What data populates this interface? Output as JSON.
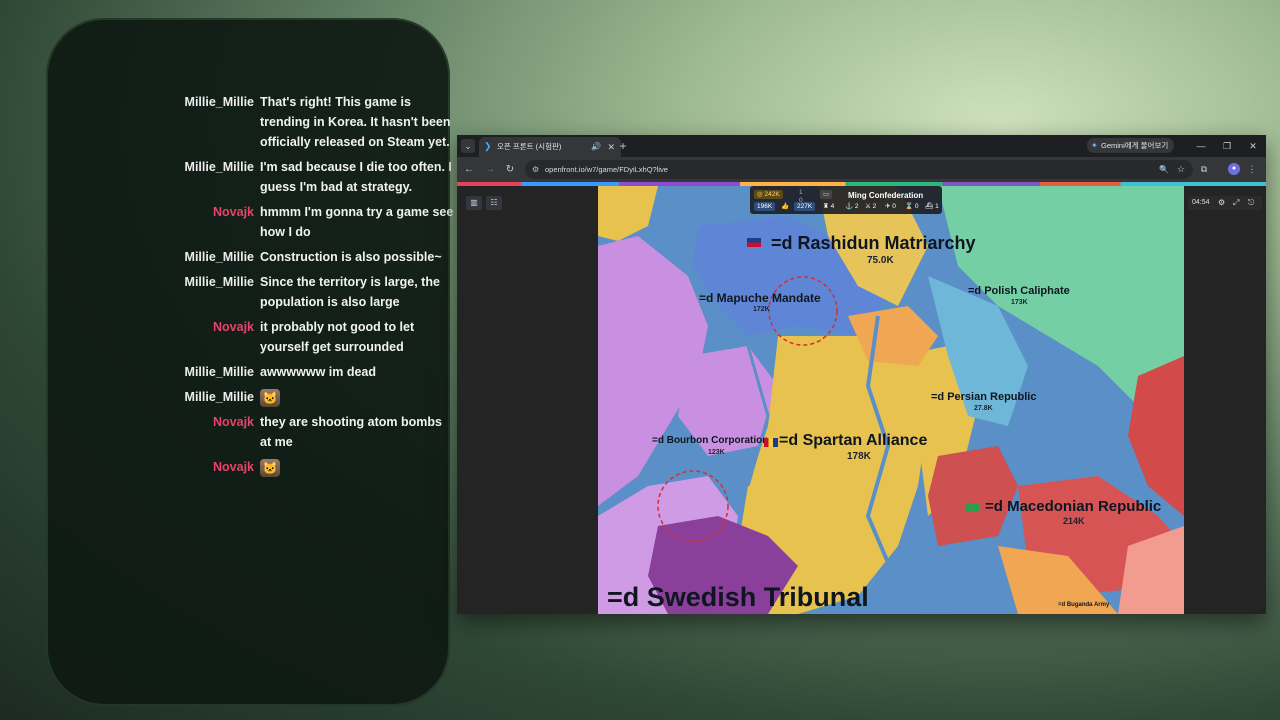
{
  "chat": {
    "messages": [
      {
        "user": "Millie_Millie",
        "text": "That's right! This game is trending in Korea. It hasn't been officially released on Steam yet.",
        "role": "millie"
      },
      {
        "user": "Millie_Millie",
        "text": "I'm sad because I die too often. I guess I'm bad at strategy.",
        "role": "millie"
      },
      {
        "user": "Novajk",
        "text": "hmmm I'm gonna try a game see how I do",
        "role": "novajk"
      },
      {
        "user": "Millie_Millie",
        "text": "Construction is also possible~",
        "role": "millie"
      },
      {
        "user": "Millie_Millie",
        "text": "Since the territory is large, the population is also large",
        "role": "millie"
      },
      {
        "user": "Novajk",
        "text": "it probably not good to let yourself get surrounded",
        "role": "novajk"
      },
      {
        "user": "Millie_Millie",
        "text": "awwwwww im dead",
        "role": "millie"
      },
      {
        "user": "Millie_Millie",
        "text": "",
        "emote": "cat-emote",
        "role": "millie"
      },
      {
        "user": "Novajk",
        "text": "they are shooting atom bombs at me",
        "role": "novajk"
      },
      {
        "user": "Novajk",
        "text": "",
        "emote": "cat-emote",
        "role": "novajk"
      }
    ]
  },
  "browser": {
    "tab_title": "오픈 프론트 (시험판)",
    "url": "openfront.io/w7/game/FDyiLxhQ?live",
    "gemini_label": "Gemini에게 물어보기",
    "icons": {
      "tab_dropdown": "chevron-down-icon",
      "favicon": "openfront-favicon-icon",
      "audio": "speaker-icon",
      "close": "close-icon",
      "new_tab": "plus-icon",
      "back": "back-arrow-icon",
      "forward": "forward-arrow-icon",
      "reload": "reload-icon",
      "site_info": "tune-icon",
      "zoom": "zoom-icon",
      "bookmark": "star-icon",
      "extensions": "puzzle-icon",
      "menu": "kebab-menu-icon"
    }
  },
  "game": {
    "timer": "04:54",
    "hud": {
      "gold": "242K",
      "troops_a": "196K",
      "troops_b": "227K",
      "player_name": "Ming Confederation",
      "stat_cities": "4",
      "stat_ports": "2",
      "stat_b": "2",
      "stat_c": "0",
      "stat_d": "0",
      "stat_e": "1",
      "small_a": "1",
      "small_b": "0"
    },
    "territories": [
      {
        "name": "=d Rashidun Matriarchy",
        "pop": "75.0K"
      },
      {
        "name": "=d Mapuche Mandate",
        "pop": "172K"
      },
      {
        "name": "=d Polish Caliphate",
        "pop": "173K"
      },
      {
        "name": "=d Persian Republic",
        "pop": "27.8K"
      },
      {
        "name": "=d Bourbon Corporation",
        "pop": "123K"
      },
      {
        "name": "=d Spartan Alliance",
        "pop": "178K"
      },
      {
        "name": "=d Macedonian Republic",
        "pop": "214K"
      },
      {
        "name": "=d Swedish Tribunal",
        "pop": ""
      },
      {
        "name": "=d Buganda Army",
        "pop": ""
      }
    ],
    "colors": {
      "ocean": "#5b8fc7",
      "yellow": "#e8c24f",
      "violet": "#c98fe0",
      "blue": "#5f86d6",
      "green": "#74cfa4",
      "red": "#d24a4a",
      "purple": "#8a3f9a"
    }
  }
}
